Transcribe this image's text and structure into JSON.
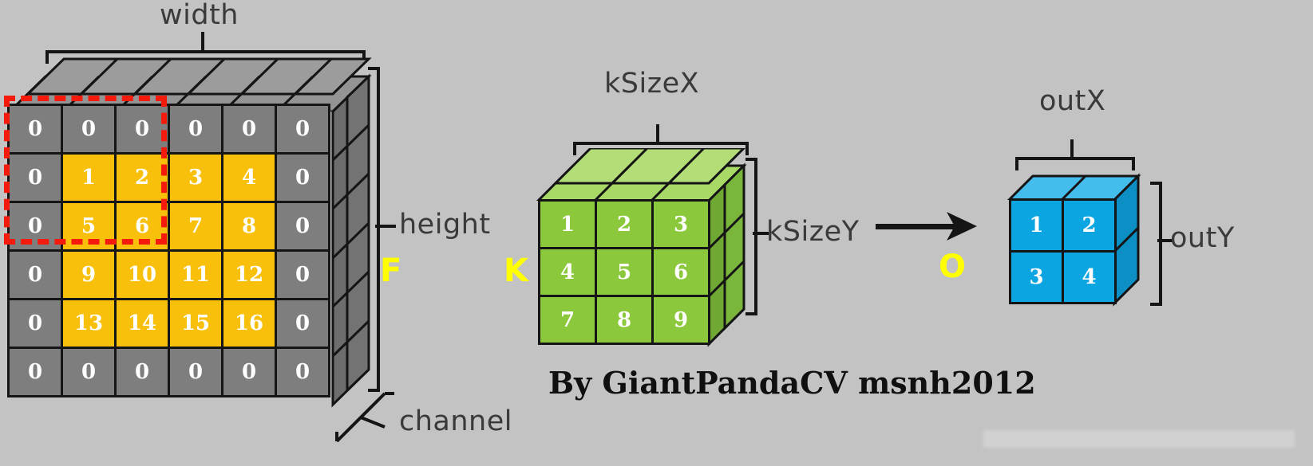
{
  "background_color": "#c3c3c3",
  "colors": {
    "input_pad_cell": "#7e7e7e",
    "input_pad_top": "#949494",
    "input_pad_side": "#6d6d6d",
    "input_data_cell": "#f8c00b",
    "kernel_front": "#8bc83c",
    "kernel_top": "#a8d866",
    "kernel_side": "#6fa832",
    "output_front": "#0ba6e1",
    "output_top": "#45bdec",
    "output_side": "#0b8fc4",
    "selection_outline": "#f41b0c",
    "stroke": "#151515",
    "label_text": "#3a3a3a",
    "symbol_text": "#ffff00"
  },
  "input": {
    "name": "input-feature-map",
    "symbol": "F",
    "width_label": "width",
    "height_label": "height",
    "channel_label": "channel",
    "rows": 6,
    "cols": 6,
    "grid": [
      [
        "0",
        "0",
        "0",
        "0",
        "0",
        "0"
      ],
      [
        "0",
        "1",
        "2",
        "3",
        "4",
        "0"
      ],
      [
        "0",
        "5",
        "6",
        "7",
        "8",
        "0"
      ],
      [
        "0",
        "9",
        "10",
        "11",
        "12",
        "0"
      ],
      [
        "0",
        "13",
        "14",
        "15",
        "16",
        "0"
      ],
      [
        "0",
        "0",
        "0",
        "0",
        "0",
        "0"
      ]
    ],
    "data_region": {
      "row_start": 1,
      "row_end": 4,
      "col_start": 1,
      "col_end": 4
    },
    "selection": {
      "row_start": 0,
      "row_end": 2,
      "col_start": 0,
      "col_end": 2
    }
  },
  "kernel": {
    "name": "convolution-kernel",
    "symbol": "K",
    "width_label": "kSizeX",
    "height_label": "kSizeY",
    "rows": 3,
    "cols": 3,
    "grid": [
      [
        "1",
        "2",
        "3"
      ],
      [
        "4",
        "5",
        "6"
      ],
      [
        "7",
        "8",
        "9"
      ]
    ]
  },
  "output": {
    "name": "output-feature-map",
    "symbol": "O",
    "width_label": "outX",
    "height_label": "outY",
    "rows": 2,
    "cols": 2,
    "grid": [
      [
        "1",
        "2"
      ],
      [
        "3",
        "4"
      ]
    ]
  },
  "credit": "By GiantPandaCV msnh2012",
  "watermark": " "
}
